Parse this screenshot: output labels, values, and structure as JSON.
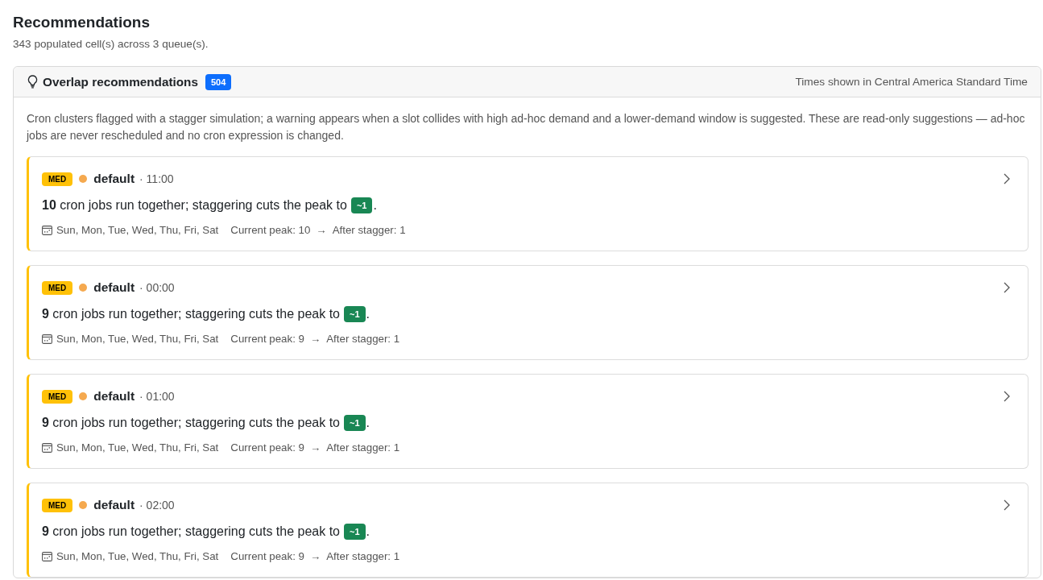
{
  "page": {
    "title": "Recommendations",
    "subtitle": "343 populated cell(s) across 3 queue(s)."
  },
  "panel": {
    "title": "Overlap recommendations",
    "count": "504",
    "timezone_note": "Times shown in Central America Standard Time",
    "description": "Cron clusters flagged with a stagger simulation; a warning appears when a slot collides with high ad-hoc demand and a lower-demand window is suggested. These are read-only suggestions — ad-hoc jobs are never rescheduled and no cron expression is changed.",
    "recommendations": [
      {
        "kind": "medium",
        "badge": "MED",
        "queue": "default",
        "time": "· 11:00",
        "summary": "**10** cron jobs run together; staggering cuts the peak to",
        "target": "~1",
        "end": ".",
        "days": "Sun, Mon, Tue, Wed, Thu, Fri, Sat",
        "current_peak": "Current peak: 10",
        "arrow": "→",
        "after_stagger": "After stagger: 1",
        "expanded": false
      },
      {
        "kind": "medium",
        "badge": "MED",
        "queue": "default",
        "time": "· 00:00",
        "summary": "**9** cron jobs run together; staggering cuts the peak to",
        "target": "~1",
        "end": ".",
        "days": "Sun, Mon, Tue, Wed, Thu, Fri, Sat",
        "current_peak": "Current peak: 9",
        "arrow": "→",
        "after_stagger": "After stagger: 1",
        "expanded": false
      },
      {
        "kind": "medium",
        "badge": "MED",
        "queue": "default",
        "time": "· 01:00",
        "summary": "**9** cron jobs run together; staggering cuts the peak to",
        "target": "~1",
        "end": ".",
        "days": "Sun, Mon, Tue, Wed, Thu, Fri, Sat",
        "current_peak": "Current peak: 9",
        "arrow": "→",
        "after_stagger": "After stagger: 1",
        "expanded": false
      },
      {
        "kind": "medium",
        "badge": "MED",
        "queue": "default",
        "time": "· 02:00",
        "summary": "**9** cron jobs run together; staggering cuts the peak to",
        "target": "~1",
        "end": ".",
        "days": "Sun, Mon, Tue, Wed, Thu, Fri, Sat",
        "current_peak": "Current peak: 9",
        "arrow": "→",
        "after_stagger": "After stagger: 1",
        "expanded": false
      }
    ]
  }
}
